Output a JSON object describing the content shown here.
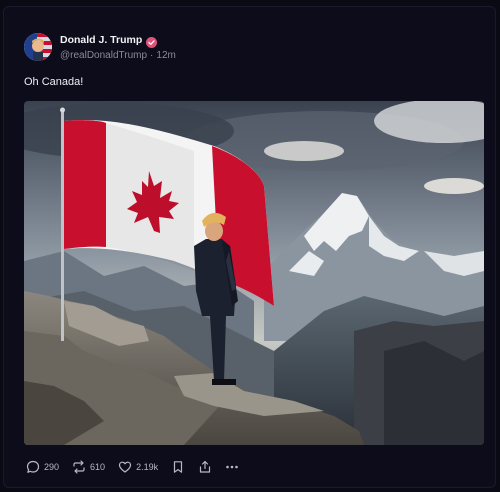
{
  "post": {
    "display_name": "Donald J. Trump",
    "handle": "@realDonaldTrump",
    "separator": "·",
    "time": "12m",
    "text": "Oh Canada!"
  },
  "actions": {
    "replies": "290",
    "reposts": "610",
    "likes": "2.19k"
  },
  "icons": {
    "verified": "verified-badge-icon",
    "reply": "reply-icon",
    "repost": "repost-icon",
    "like": "heart-icon",
    "bookmark": "bookmark-icon",
    "share": "share-icon",
    "more": "more-icon"
  },
  "colors": {
    "background": "#0d0c1b",
    "verified": "#e0527a",
    "flag_red": "#c8102e",
    "muted_text": "#8a8a98"
  }
}
